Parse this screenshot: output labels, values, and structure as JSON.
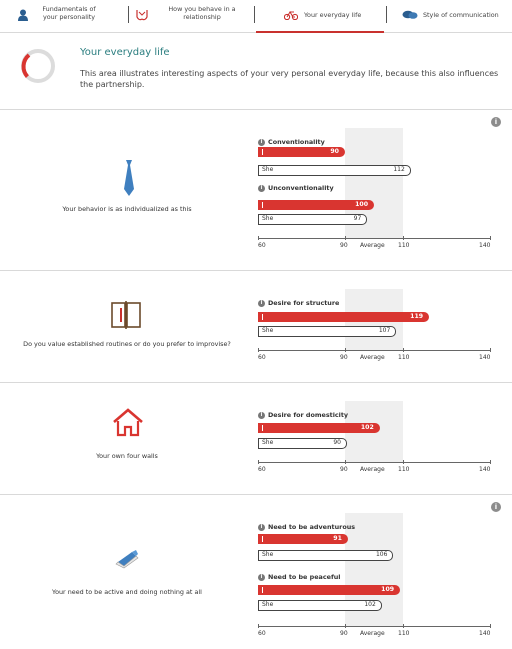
{
  "colors": {
    "accent": "#d93530",
    "teal": "#2a7d7f",
    "band": "#efefef"
  },
  "tabs": [
    {
      "label": "Fundamentals of your personality",
      "icon": "person-icon"
    },
    {
      "label": "How you behave in a relationship",
      "icon": "hands-icon"
    },
    {
      "label": "Your everyday life",
      "icon": "bicycle-icon",
      "active": true
    },
    {
      "label": "Style of communication",
      "icon": "speech-bubbles-icon"
    }
  ],
  "intro": {
    "title": "Your everyday life",
    "description": "This area illustrates interesting aspects of your very personal everyday life, because this also influences the partnership."
  },
  "axis": {
    "min": 60,
    "max": 140,
    "ticks": [
      "60",
      "90",
      "110",
      "140"
    ],
    "average_label": "Average",
    "band": [
      90,
      110
    ]
  },
  "she_label": "She",
  "sections": [
    {
      "label": "Your behavior is as individualized as this",
      "icon": "tie-icon",
      "has_info": true,
      "traits": [
        {
          "name": "Conventionality",
          "you": 90,
          "she": 112
        },
        {
          "name": "Unconventionality",
          "you": 100,
          "she": 97
        }
      ]
    },
    {
      "label": "Do you value established routines or do you prefer to improvise?",
      "icon": "planner-icon",
      "has_info": false,
      "traits": [
        {
          "name": "Desire for structure",
          "you": 119,
          "she": 107
        }
      ]
    },
    {
      "label": "Your own four walls",
      "icon": "house-icon",
      "has_info": false,
      "traits": [
        {
          "name": "Desire for domesticity",
          "you": 102,
          "she": 90
        }
      ]
    },
    {
      "label": "Your need to be active and doing nothing at all",
      "icon": "sneaker-icon",
      "has_info": true,
      "traits": [
        {
          "name": "Need to be adventurous",
          "you": 91,
          "she": 106
        },
        {
          "name": "Need to be peaceful",
          "you": 109,
          "she": 102
        }
      ]
    }
  ]
}
